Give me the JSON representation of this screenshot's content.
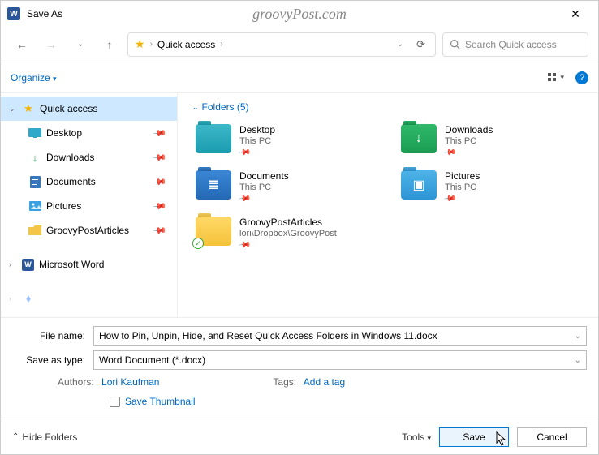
{
  "window": {
    "title": "Save As",
    "watermark": "groovyPost.com"
  },
  "nav": {
    "breadcrumb": [
      "Quick access"
    ],
    "search_placeholder": "Search Quick access"
  },
  "toolbar": {
    "organize": "Organize"
  },
  "sidebar": {
    "root": {
      "label": "Quick access"
    },
    "items": [
      {
        "label": "Desktop",
        "icon": "desktop",
        "color": "#2fa8c9"
      },
      {
        "label": "Downloads",
        "icon": "downloads",
        "color": "#2d9c55"
      },
      {
        "label": "Documents",
        "icon": "documents",
        "color": "#3977bd"
      },
      {
        "label": "Pictures",
        "icon": "pictures",
        "color": "#3ba0e0"
      },
      {
        "label": "GroovyPostArticles",
        "icon": "folder",
        "color": "#f3c648"
      }
    ],
    "tree2": {
      "label": "Microsoft Word"
    }
  },
  "content": {
    "group_label": "Folders (5)",
    "folders": [
      {
        "name": "Desktop",
        "location": "This PC",
        "iconClass": "teal",
        "glyph": ""
      },
      {
        "name": "Downloads",
        "location": "This PC",
        "iconClass": "green",
        "glyph": "↓"
      },
      {
        "name": "Documents",
        "location": "This PC",
        "iconClass": "blue",
        "glyph": "≣"
      },
      {
        "name": "Pictures",
        "location": "This PC",
        "iconClass": "sky",
        "glyph": "▣"
      },
      {
        "name": "GroovyPostArticles",
        "location": "lori\\Dropbox\\GroovyPost",
        "iconClass": "yellow",
        "glyph": "",
        "synced": true
      }
    ]
  },
  "fields": {
    "filename_label": "File name:",
    "filename_value": "How to Pin, Unpin, Hide, and Reset Quick Access Folders in Windows 11.docx",
    "type_label": "Save as type:",
    "type_value": "Word Document (*.docx)",
    "authors_label": "Authors:",
    "authors_value": "Lori Kaufman",
    "tags_label": "Tags:",
    "tags_value": "Add a tag",
    "thumb_label": "Save Thumbnail"
  },
  "footer": {
    "hide_folders": "Hide Folders",
    "tools": "Tools",
    "save": "Save",
    "cancel": "Cancel"
  }
}
